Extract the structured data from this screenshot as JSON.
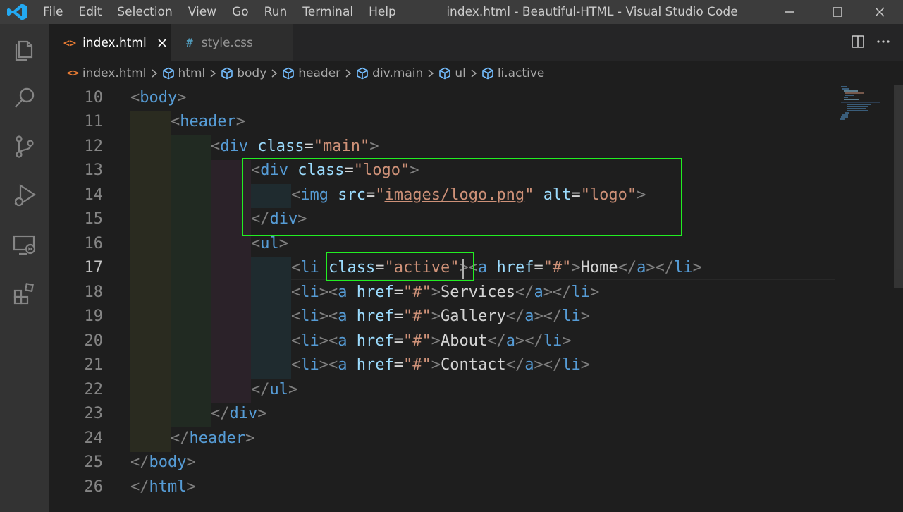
{
  "window": {
    "title": "index.html - Beautiful-HTML - Visual Studio Code",
    "menu": [
      "File",
      "Edit",
      "Selection",
      "View",
      "Go",
      "Run",
      "Terminal",
      "Help"
    ]
  },
  "activity_bar": {
    "icons": [
      "explorer-icon",
      "search-icon",
      "source-control-icon",
      "run-debug-icon",
      "remote-explorer-icon",
      "extensions-icon"
    ]
  },
  "tabs": [
    {
      "label": "index.html",
      "icon": "<>",
      "active": true
    },
    {
      "label": "style.css",
      "icon": "#",
      "active": false
    }
  ],
  "breadcrumbs": {
    "file": "index.html",
    "items": [
      "html",
      "body",
      "header",
      "div.main",
      "ul",
      "li.active"
    ]
  },
  "editor": {
    "current_line": 17,
    "line_numbers": [
      "10",
      "11",
      "12",
      "13",
      "14",
      "15",
      "16",
      "17",
      "18",
      "19",
      "20",
      "21",
      "22",
      "23",
      "24",
      "25",
      "26"
    ],
    "lines": [
      [
        [
          "t",
          "<"
        ],
        [
          "n",
          "body"
        ],
        [
          "t",
          ">"
        ]
      ],
      [
        [
          "t",
          "<"
        ],
        [
          "n",
          "header"
        ],
        [
          "t",
          ">"
        ]
      ],
      [
        [
          "t",
          "<"
        ],
        [
          "n",
          "div"
        ],
        [
          "x",
          " "
        ],
        [
          "a",
          "class"
        ],
        [
          "x",
          "="
        ],
        [
          "s",
          "\"main\""
        ],
        [
          "t",
          ">"
        ]
      ],
      [
        [
          "t",
          "<"
        ],
        [
          "n",
          "div"
        ],
        [
          "x",
          " "
        ],
        [
          "a",
          "class"
        ],
        [
          "x",
          "="
        ],
        [
          "s",
          "\"logo\""
        ],
        [
          "t",
          ">"
        ]
      ],
      [
        [
          "t",
          "<"
        ],
        [
          "n",
          "img"
        ],
        [
          "x",
          " "
        ],
        [
          "a",
          "src"
        ],
        [
          "x",
          "="
        ],
        [
          "s",
          "\""
        ],
        [
          "su",
          "images/logo.png"
        ],
        [
          "s",
          "\""
        ],
        [
          "x",
          " "
        ],
        [
          "a",
          "alt"
        ],
        [
          "x",
          "="
        ],
        [
          "s",
          "\"logo\""
        ],
        [
          "t",
          ">"
        ]
      ],
      [
        [
          "t",
          "</"
        ],
        [
          "n",
          "div"
        ],
        [
          "t",
          ">"
        ]
      ],
      [
        [
          "t",
          "<"
        ],
        [
          "n",
          "ul"
        ],
        [
          "t",
          ">"
        ]
      ],
      [
        [
          "t",
          "<"
        ],
        [
          "n",
          "li"
        ],
        [
          "x",
          " "
        ],
        [
          "a",
          "class"
        ],
        [
          "x",
          "="
        ],
        [
          "s",
          "\"active\""
        ],
        [
          "t",
          ">"
        ],
        [
          "t",
          "<"
        ],
        [
          "n",
          "a"
        ],
        [
          "x",
          " "
        ],
        [
          "a",
          "href"
        ],
        [
          "x",
          "="
        ],
        [
          "s",
          "\"#\""
        ],
        [
          "t",
          ">"
        ],
        [
          "x",
          "Home"
        ],
        [
          "t",
          "</"
        ],
        [
          "n",
          "a"
        ],
        [
          "t",
          "></"
        ],
        [
          "n",
          "li"
        ],
        [
          "t",
          ">"
        ]
      ],
      [
        [
          "t",
          "<"
        ],
        [
          "n",
          "li"
        ],
        [
          "t",
          "><"
        ],
        [
          "n",
          "a"
        ],
        [
          "x",
          " "
        ],
        [
          "a",
          "href"
        ],
        [
          "x",
          "="
        ],
        [
          "s",
          "\"#\""
        ],
        [
          "t",
          ">"
        ],
        [
          "x",
          "Services"
        ],
        [
          "t",
          "</"
        ],
        [
          "n",
          "a"
        ],
        [
          "t",
          "></"
        ],
        [
          "n",
          "li"
        ],
        [
          "t",
          ">"
        ]
      ],
      [
        [
          "t",
          "<"
        ],
        [
          "n",
          "li"
        ],
        [
          "t",
          "><"
        ],
        [
          "n",
          "a"
        ],
        [
          "x",
          " "
        ],
        [
          "a",
          "href"
        ],
        [
          "x",
          "="
        ],
        [
          "s",
          "\"#\""
        ],
        [
          "t",
          ">"
        ],
        [
          "x",
          "Gallery"
        ],
        [
          "t",
          "</"
        ],
        [
          "n",
          "a"
        ],
        [
          "t",
          "></"
        ],
        [
          "n",
          "li"
        ],
        [
          "t",
          ">"
        ]
      ],
      [
        [
          "t",
          "<"
        ],
        [
          "n",
          "li"
        ],
        [
          "t",
          "><"
        ],
        [
          "n",
          "a"
        ],
        [
          "x",
          " "
        ],
        [
          "a",
          "href"
        ],
        [
          "x",
          "="
        ],
        [
          "s",
          "\"#\""
        ],
        [
          "t",
          ">"
        ],
        [
          "x",
          "About"
        ],
        [
          "t",
          "</"
        ],
        [
          "n",
          "a"
        ],
        [
          "t",
          "></"
        ],
        [
          "n",
          "li"
        ],
        [
          "t",
          ">"
        ]
      ],
      [
        [
          "t",
          "<"
        ],
        [
          "n",
          "li"
        ],
        [
          "t",
          "><"
        ],
        [
          "n",
          "a"
        ],
        [
          "x",
          " "
        ],
        [
          "a",
          "href"
        ],
        [
          "x",
          "="
        ],
        [
          "s",
          "\"#\""
        ],
        [
          "t",
          ">"
        ],
        [
          "x",
          "Contact"
        ],
        [
          "t",
          "</"
        ],
        [
          "n",
          "a"
        ],
        [
          "t",
          "></"
        ],
        [
          "n",
          "li"
        ],
        [
          "t",
          ">"
        ]
      ],
      [
        [
          "t",
          "</"
        ],
        [
          "n",
          "ul"
        ],
        [
          "t",
          ">"
        ]
      ],
      [
        [
          "t",
          "</"
        ],
        [
          "n",
          "div"
        ],
        [
          "t",
          ">"
        ]
      ],
      [
        [
          "t",
          "</"
        ],
        [
          "n",
          "header"
        ],
        [
          "t",
          ">"
        ]
      ],
      [
        [
          "t",
          "</"
        ],
        [
          "n",
          "body"
        ],
        [
          "t",
          ">"
        ]
      ],
      [
        [
          "t",
          "</"
        ],
        [
          "n",
          "html"
        ],
        [
          "t",
          ">"
        ]
      ]
    ]
  },
  "colors": {
    "tag_bracket": "#808080",
    "tag_name": "#569cd6",
    "attribute": "#9cdcfe",
    "string": "#ce9178",
    "text": "#d4d4d4",
    "highlight_box": "#22ee22",
    "vscode_blue": "#23a9f2"
  }
}
